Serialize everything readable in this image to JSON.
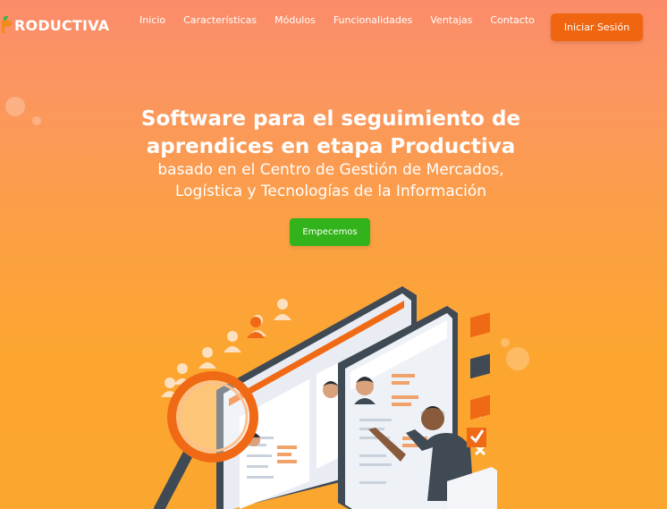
{
  "brand": {
    "name": "RODUCTIVA",
    "logo_icon": "sprout-icon"
  },
  "nav": {
    "items": [
      {
        "label": "Inicio"
      },
      {
        "label": "Características"
      },
      {
        "label": "Módulos"
      },
      {
        "label": "Funcionalidades"
      },
      {
        "label": "Ventajas"
      },
      {
        "label": "Contacto"
      }
    ],
    "login_label": "Iniciar Sesión"
  },
  "hero": {
    "title_line1": "Software para el seguimiento de",
    "title_line2": "aprendices en etapa Productiva",
    "subtitle_line1": "basado en el Centro de Gestión de Mercados,",
    "subtitle_line2": "Logística y Tecnologías de la Información",
    "cta_label": "Empecemos"
  },
  "colors": {
    "accent": "#f0650f",
    "cta": "#33b31b",
    "background_top": "#fb8c6a",
    "background_bottom": "#fba62e"
  },
  "illustration": {
    "icons": [
      "monitor-icon",
      "magnifier-icon",
      "person-icon",
      "checkbox-check-icon",
      "checkbox-cross-icon",
      "user-silhouette-icon"
    ]
  }
}
